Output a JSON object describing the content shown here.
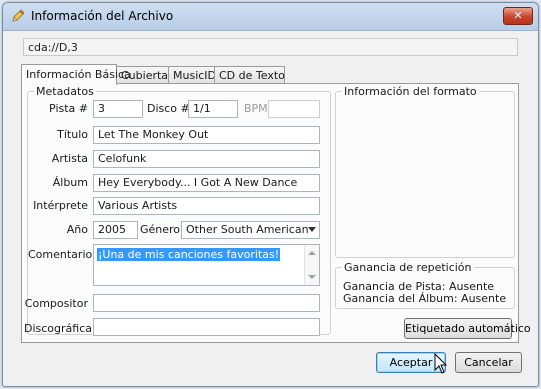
{
  "window": {
    "title": "Información del Archivo",
    "close_label": "✕"
  },
  "path": "cda://D,3",
  "tabs": [
    {
      "label": "Información Básica",
      "active": true
    },
    {
      "label": "Cubierta",
      "active": false
    },
    {
      "label": "MusicID",
      "active": false
    },
    {
      "label": "CD de Texto",
      "active": false
    }
  ],
  "metadata": {
    "legend": "Metadatos",
    "track_label": "Pista #",
    "track_value": "3",
    "disc_label": "Disco #",
    "disc_value": "1/1",
    "bpm_label": "BPM",
    "bpm_value": "",
    "title_label": "Título",
    "title_value": "Let The Monkey Out",
    "artist_label": "Artista",
    "artist_value": "Celofunk",
    "album_label": "Álbum",
    "album_value": "Hey Everybody... I Got A New Dance",
    "performer_label": "Intérprete",
    "performer_value": "Various Artists",
    "year_label": "Año",
    "year_value": "2005",
    "genre_label": "Género",
    "genre_value": "Other South American",
    "comment_label": "Comentario",
    "comment_value": "¡Una de mis canciones favoritas!",
    "composer_label": "Compositor",
    "composer_value": "",
    "label_label": "Discográfica",
    "label_value": ""
  },
  "format_info": {
    "legend": "Información del formato"
  },
  "replay_gain": {
    "legend": "Ganancia de repetición",
    "track_line": "Ganancia de Pista: Ausente",
    "album_line": "Ganancia del Álbum: Ausente"
  },
  "buttons": {
    "autotag": "Etiquetado automático",
    "accept": "Aceptar",
    "cancel": "Cancelar"
  },
  "colors": {
    "selection": "#3399ff",
    "default_button": "#bee6fd",
    "close_button": "#c9452c"
  }
}
